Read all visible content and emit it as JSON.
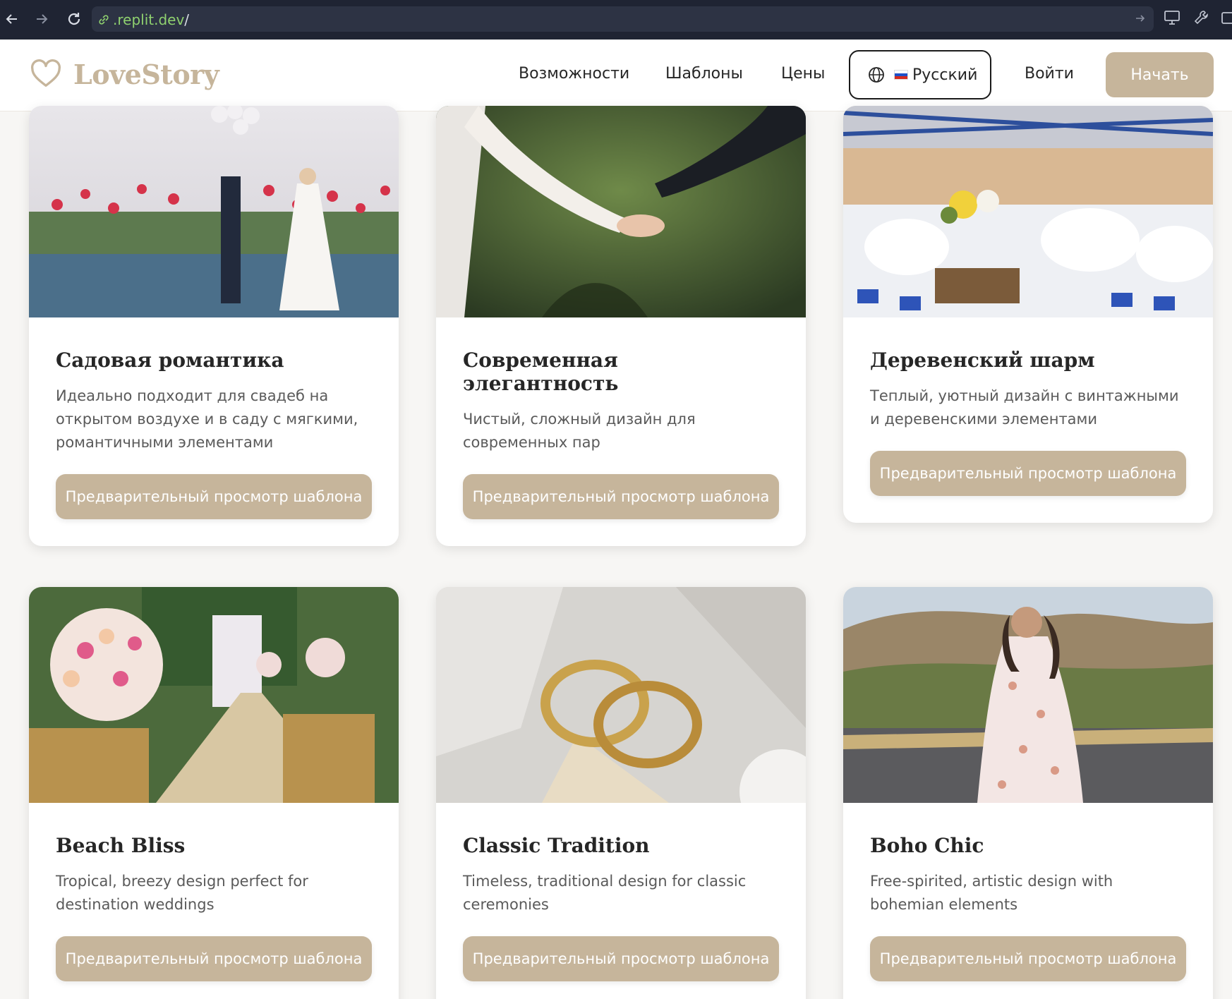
{
  "browser": {
    "url_host": ".replit.dev",
    "url_path": "/"
  },
  "header": {
    "logo_text": "LoveStory",
    "nav": [
      "Возможности",
      "Шаблоны",
      "Цены"
    ],
    "language_label": "Русский",
    "login_label": "Войти",
    "start_label": "Начать"
  },
  "colors": {
    "accent": "#c6b59b",
    "text": "#262626",
    "muted": "#5a5a5a"
  },
  "templates": [
    {
      "title": "Садовая романтика",
      "description": "Идеально подходит для свадеб на открытом воздухе и в саду с мягкими, романтичными элементами",
      "button": "Предварительный просмотр шаблона"
    },
    {
      "title": "Современная элегантность",
      "description": "Чистый, сложный дизайн для современных пар",
      "button": "Предварительный просмотр шаблона"
    },
    {
      "title": "Деревенский шарм",
      "description": "Теплый, уютный дизайн с винтажными и деревенскими элементами",
      "button": "Предварительный просмотр шаблона"
    },
    {
      "title": "Beach Bliss",
      "description": "Tropical, breezy design perfect for destination weddings",
      "button": "Предварительный просмотр шаблона"
    },
    {
      "title": "Classic Tradition",
      "description": "Timeless, traditional design for classic ceremonies",
      "button": "Предварительный просмотр шаблона"
    },
    {
      "title": "Boho Chic",
      "description": "Free-spirited, artistic design with bohemian elements",
      "button": "Предварительный просмотр шаблона"
    }
  ]
}
